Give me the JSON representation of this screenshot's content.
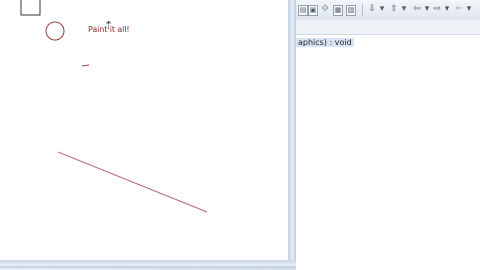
{
  "applet": {
    "paint_text": "Paint it all!"
  },
  "ide": {
    "toolbar": {
      "buttons": [
        "layout-icon",
        "toggle-icon",
        "pin-icon",
        "outline-icon",
        "hierarchy-icon",
        "next-annotation-icon",
        "previous-annotation-icon",
        "back-icon",
        "forward-icon"
      ]
    },
    "outline": {
      "signature": "aphics) : void"
    }
  }
}
